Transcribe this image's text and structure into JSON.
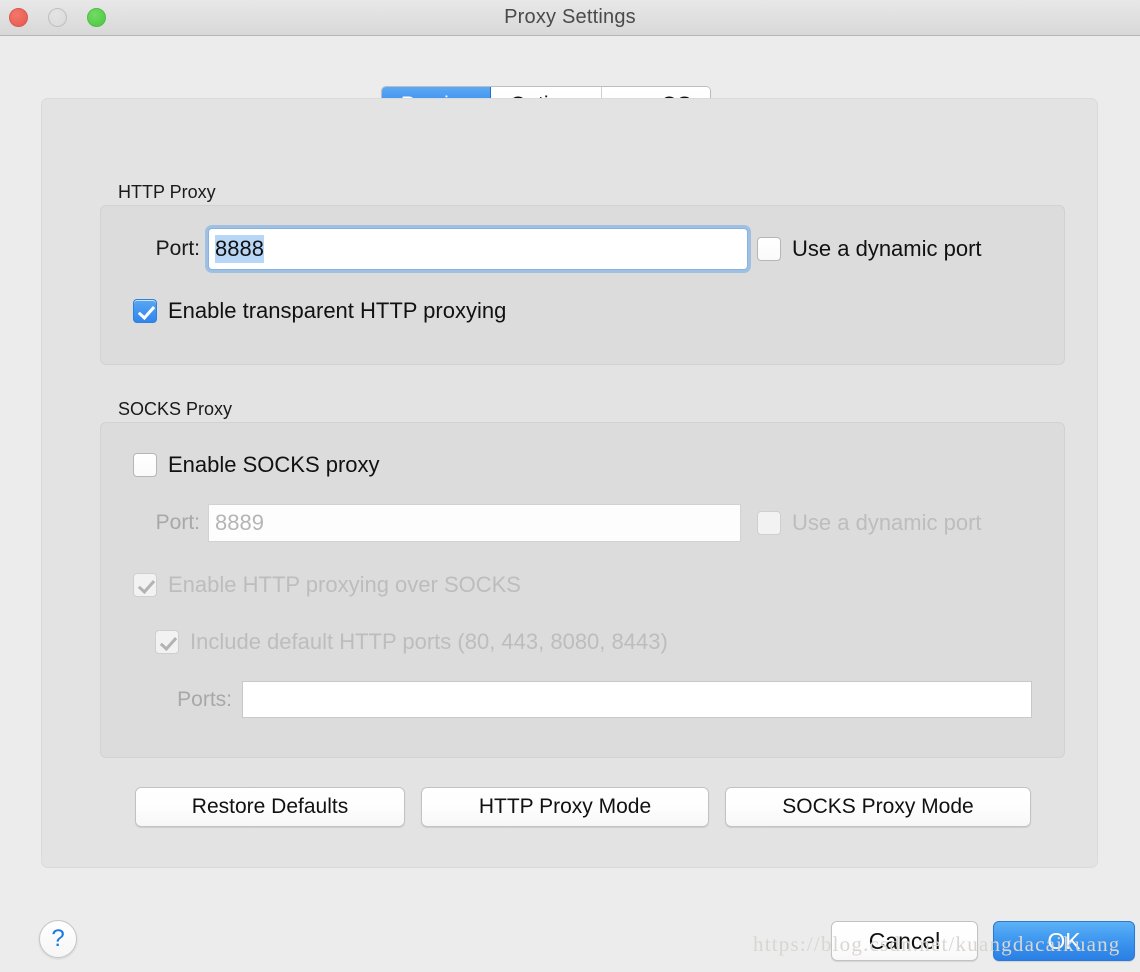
{
  "window": {
    "title": "Proxy Settings",
    "traffic_lights": [
      {
        "name": "close",
        "color": "#ea6256"
      },
      {
        "name": "minimize",
        "color": "#dcdcdc"
      },
      {
        "name": "maximize",
        "color": "#57cd4a"
      }
    ]
  },
  "tabs": [
    {
      "label": "Proxies",
      "active": true
    },
    {
      "label": "Options",
      "active": false
    },
    {
      "label": "macOS",
      "active": false
    }
  ],
  "http_section": {
    "title": "HTTP Proxy",
    "port_label": "Port:",
    "port_value": "8888",
    "dynamic_port_label": "Use a dynamic port",
    "dynamic_port_checked": false,
    "transparent_label": "Enable transparent HTTP proxying",
    "transparent_checked": true
  },
  "socks_section": {
    "title": "SOCKS Proxy",
    "enable_label": "Enable SOCKS proxy",
    "enable_checked": false,
    "port_label": "Port:",
    "port_value": "8889",
    "dynamic_port_label": "Use a dynamic port",
    "dynamic_port_checked": false,
    "http_over_socks_label": "Enable HTTP proxying over SOCKS",
    "http_over_socks_checked": true,
    "include_default_ports_label": "Include default HTTP ports (80, 443, 8080, 8443)",
    "include_default_ports_checked": true,
    "ports_label": "Ports:",
    "ports_value": ""
  },
  "action_buttons": {
    "restore_defaults": "Restore Defaults",
    "http_proxy_mode": "HTTP Proxy Mode",
    "socks_proxy_mode": "SOCKS Proxy Mode"
  },
  "footer": {
    "help": "?",
    "cancel": "Cancel",
    "ok": "OK"
  },
  "watermark": "https://blog.csdn.net/kuangdacaikuang",
  "colors": {
    "accent_blue": "#2f86ed",
    "window_bg": "#ececec",
    "panel_bg": "#e3e3e3",
    "group_bg": "#dcdcdc",
    "selection_blue": "#b8d6f5"
  }
}
